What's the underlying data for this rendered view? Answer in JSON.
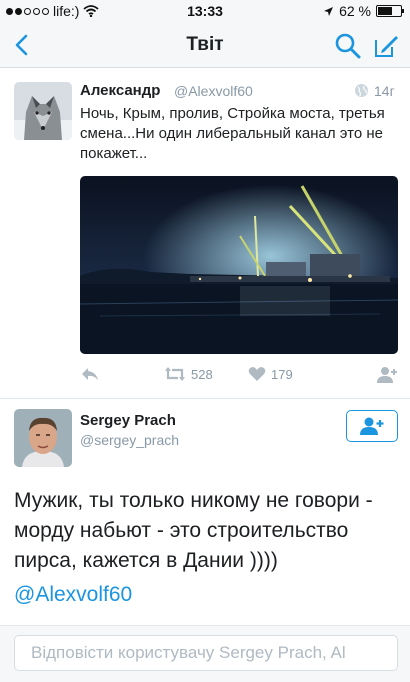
{
  "status_bar": {
    "carrier": "life:)",
    "time": "13:33",
    "battery": "62 %",
    "battery_level": 0.62,
    "signal_bars_filled": 2,
    "signal_bars_total": 5
  },
  "nav": {
    "title": "Твіт",
    "back_icon": "chevron-left-icon",
    "search_icon": "search-icon",
    "compose_icon": "compose-icon",
    "accent_color": "#1b95e0"
  },
  "tweet": {
    "author_name": "Александр",
    "author_handle": "@Alexvolf60",
    "time": "14г",
    "text": "Ночь, Крым, пролив, Стройка моста, третья смена...Ни один либеральный канал это не покажет...",
    "retweets": "528",
    "likes": "179"
  },
  "reply": {
    "author_name": "Sergey Prach",
    "author_handle": "@sergey_prach",
    "text": "Мужик, ты только никому не говори - морду набьют - это строительство пирса, кажется в Дании ))))",
    "mention": "@Alexvolf60"
  },
  "reply_bar": {
    "placeholder": "Відповісти користувачу Sergey Prach, Al"
  }
}
